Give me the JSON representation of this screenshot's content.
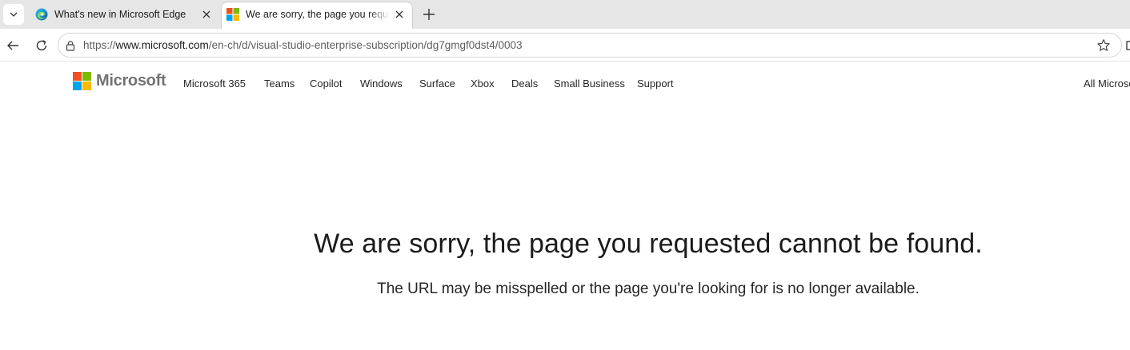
{
  "browser": {
    "tabs": [
      {
        "title": "What's new in Microsoft Edge",
        "active": false,
        "favicon": "edge-icon"
      },
      {
        "title": "We are sorry, the page you requested cannot be found",
        "active": true,
        "favicon": "microsoft-logo-icon"
      }
    ],
    "address_bar": {
      "url_prefix": "https://",
      "url_host": "www.microsoft.com",
      "url_path": "/en-ch/d/visual-studio-enterprise-subscription/dg7gmgf0dst4/0003"
    }
  },
  "site": {
    "brand": "Microsoft",
    "nav": [
      "Microsoft 365",
      "Teams",
      "Copilot",
      "Windows",
      "Surface",
      "Xbox",
      "Deals",
      "Small Business",
      "Support"
    ],
    "all_microsoft": "All Microsoft"
  },
  "error": {
    "title": "We are sorry, the page you requested cannot be found.",
    "message": "The URL may be misspelled or the page you're looking for is no longer available."
  },
  "colors": {
    "logo_red": "#f25022",
    "logo_green": "#7fba00",
    "logo_blue": "#00a4ef",
    "logo_yellow": "#ffb900"
  }
}
